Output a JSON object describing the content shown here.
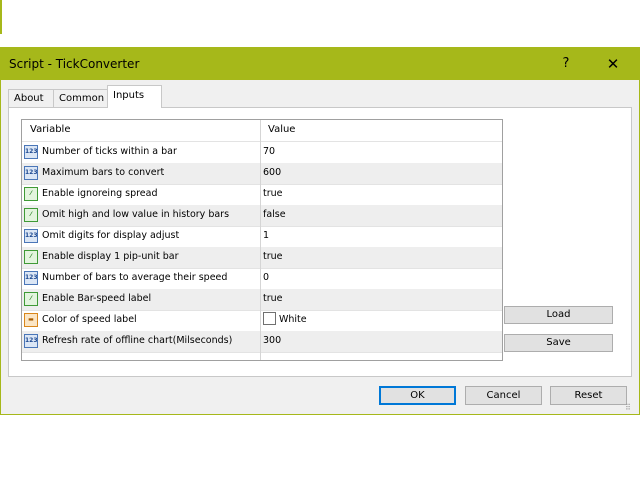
{
  "window": {
    "title": "Script - TickConverter",
    "help_label": "?",
    "close_label": "✕"
  },
  "tabs": [
    {
      "label": "About"
    },
    {
      "label": "Common"
    },
    {
      "label": "Inputs",
      "active": true
    }
  ],
  "grid": {
    "headers": {
      "variable": "Variable",
      "value": "Value"
    },
    "rows": [
      {
        "icon": "numeric-icon",
        "label": "Number of ticks within a bar",
        "value": "70"
      },
      {
        "icon": "numeric-icon",
        "label": "Maximum bars to convert",
        "value": "600"
      },
      {
        "icon": "boolean-icon",
        "label": "Enable ignoreing spread",
        "value": "true"
      },
      {
        "icon": "boolean-icon",
        "label": "Omit high and low value in history bars",
        "value": "false"
      },
      {
        "icon": "numeric-icon",
        "label": "Omit digits for display adjust",
        "value": "1"
      },
      {
        "icon": "boolean-icon",
        "label": "Enable display 1 pip-unit bar",
        "value": "true"
      },
      {
        "icon": "numeric-icon",
        "label": "Number of bars to average their speed",
        "value": "0"
      },
      {
        "icon": "boolean-icon",
        "label": "Enable Bar-speed label",
        "value": "true"
      },
      {
        "icon": "color-icon",
        "label": "Color of speed label",
        "value": "White",
        "swatch_color": "#ffffff"
      },
      {
        "icon": "numeric-icon",
        "label": "Refresh rate of offline chart(Milseconds)",
        "value": "300"
      }
    ],
    "icon_glyphs": {
      "numeric": "123",
      "boolean": "⁄",
      "color": "▬"
    }
  },
  "buttons": {
    "load": "Load",
    "save": "Save",
    "ok": "OK",
    "cancel": "Cancel",
    "reset": "Reset"
  },
  "colors": {
    "titlebar": "#a6b81a",
    "ok_focus_border": "#0078d7"
  }
}
